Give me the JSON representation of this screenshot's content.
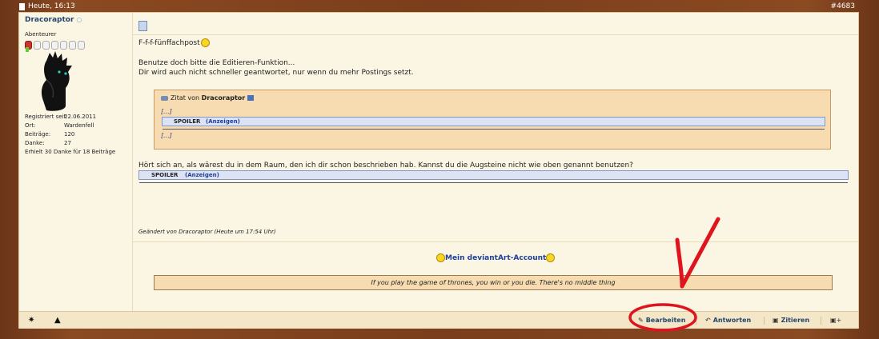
{
  "titlebar": {
    "date": "Heute, 16:13",
    "post_number": "#4683"
  },
  "user": {
    "name": "Dracoraptor",
    "online_indicator": "○",
    "rank": "Abenteurer",
    "stats": [
      {
        "label": "Registriert seit:",
        "value": "22.06.2011"
      },
      {
        "label": "Ort:",
        "value": "Wardenfell"
      },
      {
        "label": "Beiträge:",
        "value": "120"
      },
      {
        "label": "Danke:",
        "value": "27"
      }
    ],
    "thanks_line": "Erhielt 30 Danke für 18 Beiträge"
  },
  "post": {
    "line1": "F-f-f-fünffachpost",
    "line2": "Benutze doch bitte die Editieren-Funktion...",
    "line3": "Dir wird auch nicht schneller geantwortet, nur wenn du mehr Postings setzt.",
    "quote": {
      "prefix": "Zitat von",
      "author": "Dracoraptor",
      "ellipsis_top": "[...]",
      "ellipsis_bottom": "[...]",
      "spoiler_label": "SPOILER",
      "spoiler_show": "(Anzeigen)"
    },
    "line4": "Hört sich an, als wärest du in dem Raum, den ich dir schon beschrieben hab. Kannst du die Augsteine nicht wie oben genannt benutzen?",
    "spoiler_label": "SPOILER",
    "spoiler_show": "(Anzeigen)",
    "edited": "Geändert von Dracoraptor (Heute um 17:54 Uhr)"
  },
  "signature": {
    "link": "Mein deviantArt-Account",
    "quote": "If you play the game of thrones, you win or you die. There's no middle thing"
  },
  "footer": {
    "edit": "Bearbeiten",
    "reply": "Antworten",
    "quote": "Zitieren",
    "icons": [
      "star-icon",
      "warning-icon",
      "pencil-icon",
      "reply-arrow-icon",
      "quote-bubble-icon",
      "multiquote-plus-icon"
    ]
  },
  "colors": {
    "frame": "#7a3e1c",
    "panel": "#fbf6e4",
    "quote_bg": "#f7dcb1",
    "link": "#1f3f9a",
    "annotation": "#e0141e"
  }
}
